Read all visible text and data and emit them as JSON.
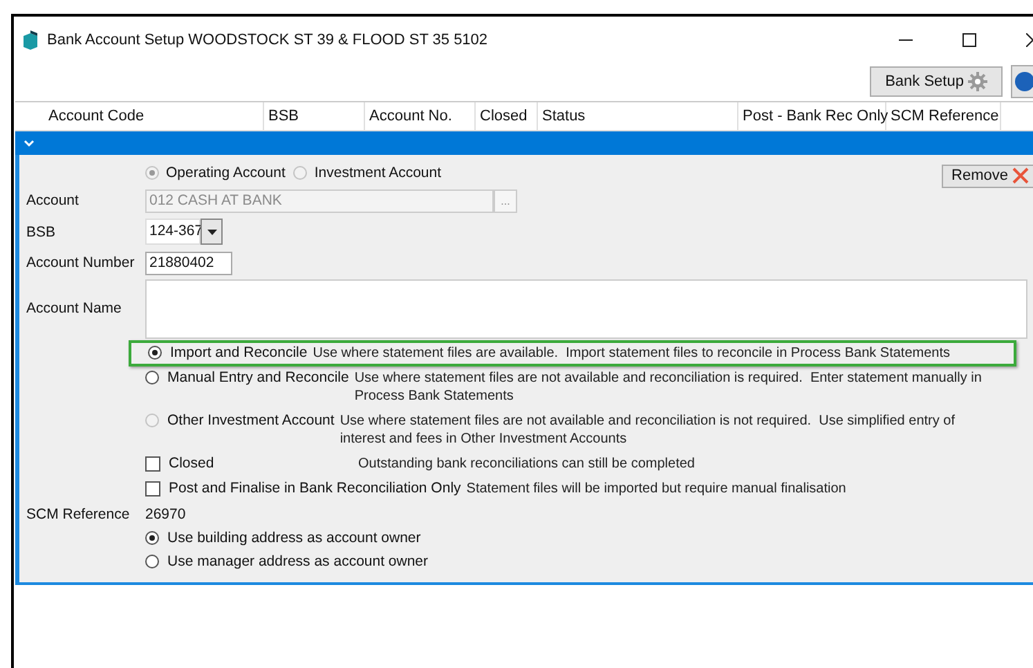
{
  "window": {
    "title": "Bank Account Setup WOODSTOCK ST 39 & FLOOD ST 35 5102"
  },
  "toolbar": {
    "bank_setup_button": "Bank Setup"
  },
  "table": {
    "columns": [
      "Account Code",
      "BSB",
      "Account No.",
      "Closed",
      "Status",
      "Post - Bank Rec Only",
      "SCM Reference"
    ],
    "row": {
      "expanded": true
    }
  },
  "panel": {
    "account_types": [
      {
        "label": "Operating Account",
        "selected": true,
        "disabled": true
      },
      {
        "label": "Investment Account",
        "selected": false,
        "disabled": true
      }
    ],
    "remove_button": "Remove",
    "account": {
      "label": "Account",
      "value": "012 CASH AT BANK",
      "disabled": true,
      "browse": "..."
    },
    "bsb": {
      "label": "BSB",
      "value": "124-367"
    },
    "account_number": {
      "label": "Account Number",
      "value": "21880402"
    },
    "account_name": {
      "label": "Account Name"
    },
    "reconcile_modes": [
      {
        "label": "Import and Reconcile",
        "description": "Use where statement files are available.  Import statement files to reconcile in Process Bank Statements",
        "selected": true,
        "disabled": false,
        "highlighted": true
      },
      {
        "label": "Manual Entry and Reconcile",
        "description": "Use where statement files are not available and reconciliation is required.  Enter statement manually in Process Bank Statements",
        "selected": false,
        "disabled": false,
        "highlighted": false
      },
      {
        "label": "Other Investment Account",
        "description": "Use where statement files are not available and reconciliation is not required.  Use simplified entry of interest and fees in Other Investment Accounts",
        "selected": false,
        "disabled": true,
        "highlighted": false
      }
    ],
    "checkboxes": [
      {
        "label": "Closed",
        "description": "Outstanding bank reconciliations can still be completed",
        "checked": false,
        "aligned": true
      },
      {
        "label": "Post and Finalise in Bank Reconciliation Only",
        "description": "Statement files will be imported but require manual finalisation",
        "checked": false,
        "aligned": false
      }
    ],
    "scm_reference": {
      "label": "SCM Reference",
      "value": "26970"
    },
    "owner_options": [
      {
        "label": "Use building address as account owner",
        "selected": true
      },
      {
        "label": "Use manager address as account owner",
        "selected": false
      }
    ]
  }
}
